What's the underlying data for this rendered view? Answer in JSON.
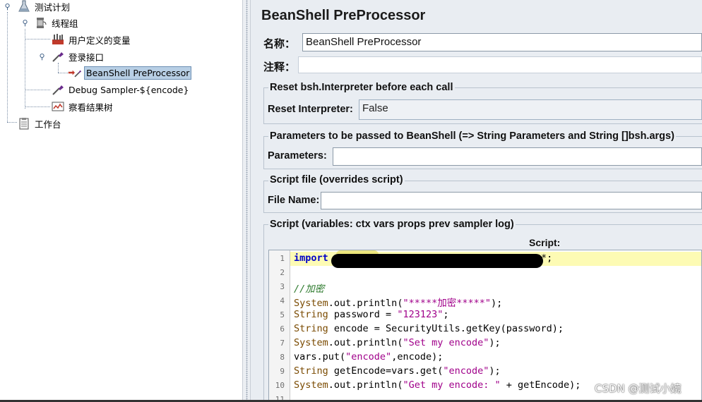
{
  "tree": {
    "items": [
      {
        "label": "测试计划",
        "icon": "test-plan-flask-icon"
      },
      {
        "label": "线程组",
        "icon": "thread-group-spool-icon"
      },
      {
        "label": "用户定义的变量",
        "icon": "config-tools-icon"
      },
      {
        "label": "登录接口",
        "icon": "sampler-pipette-icon"
      },
      {
        "label": "BeanShell PreProcessor",
        "icon": "preprocessor-arrow-icon"
      },
      {
        "label": "Debug Sampler-${encode}",
        "icon": "sampler-pipette-icon"
      },
      {
        "label": "察看结果树",
        "icon": "listener-chart-icon"
      },
      {
        "label": "工作台",
        "icon": "workbench-clipboard-icon"
      }
    ]
  },
  "panel": {
    "title": "BeanShell PreProcessor",
    "name_label": "名称：",
    "name_value": "BeanShell PreProcessor",
    "comment_label": "注释：",
    "comment_value": "",
    "reset_group_title": "Reset bsh.Interpreter before each call",
    "reset_label": "Reset Interpreter:",
    "reset_value": "False",
    "params_group_title": "Parameters to be passed to BeanShell (=> String Parameters and String []bsh.args)",
    "params_label": "Parameters:",
    "params_value": "",
    "file_group_title": "Script file (overrides script)",
    "file_label": "File Name:",
    "file_value": "",
    "script_group_title": "Script (variables: ctx vars props prev sampler log)",
    "script_caption": "Script:"
  },
  "editor": {
    "line_numbers": [
      "1",
      "2",
      "3",
      "4",
      "5",
      "6",
      "7",
      "8",
      "9",
      "10",
      "11"
    ]
  },
  "watermark": "CSDN @测试小婉"
}
